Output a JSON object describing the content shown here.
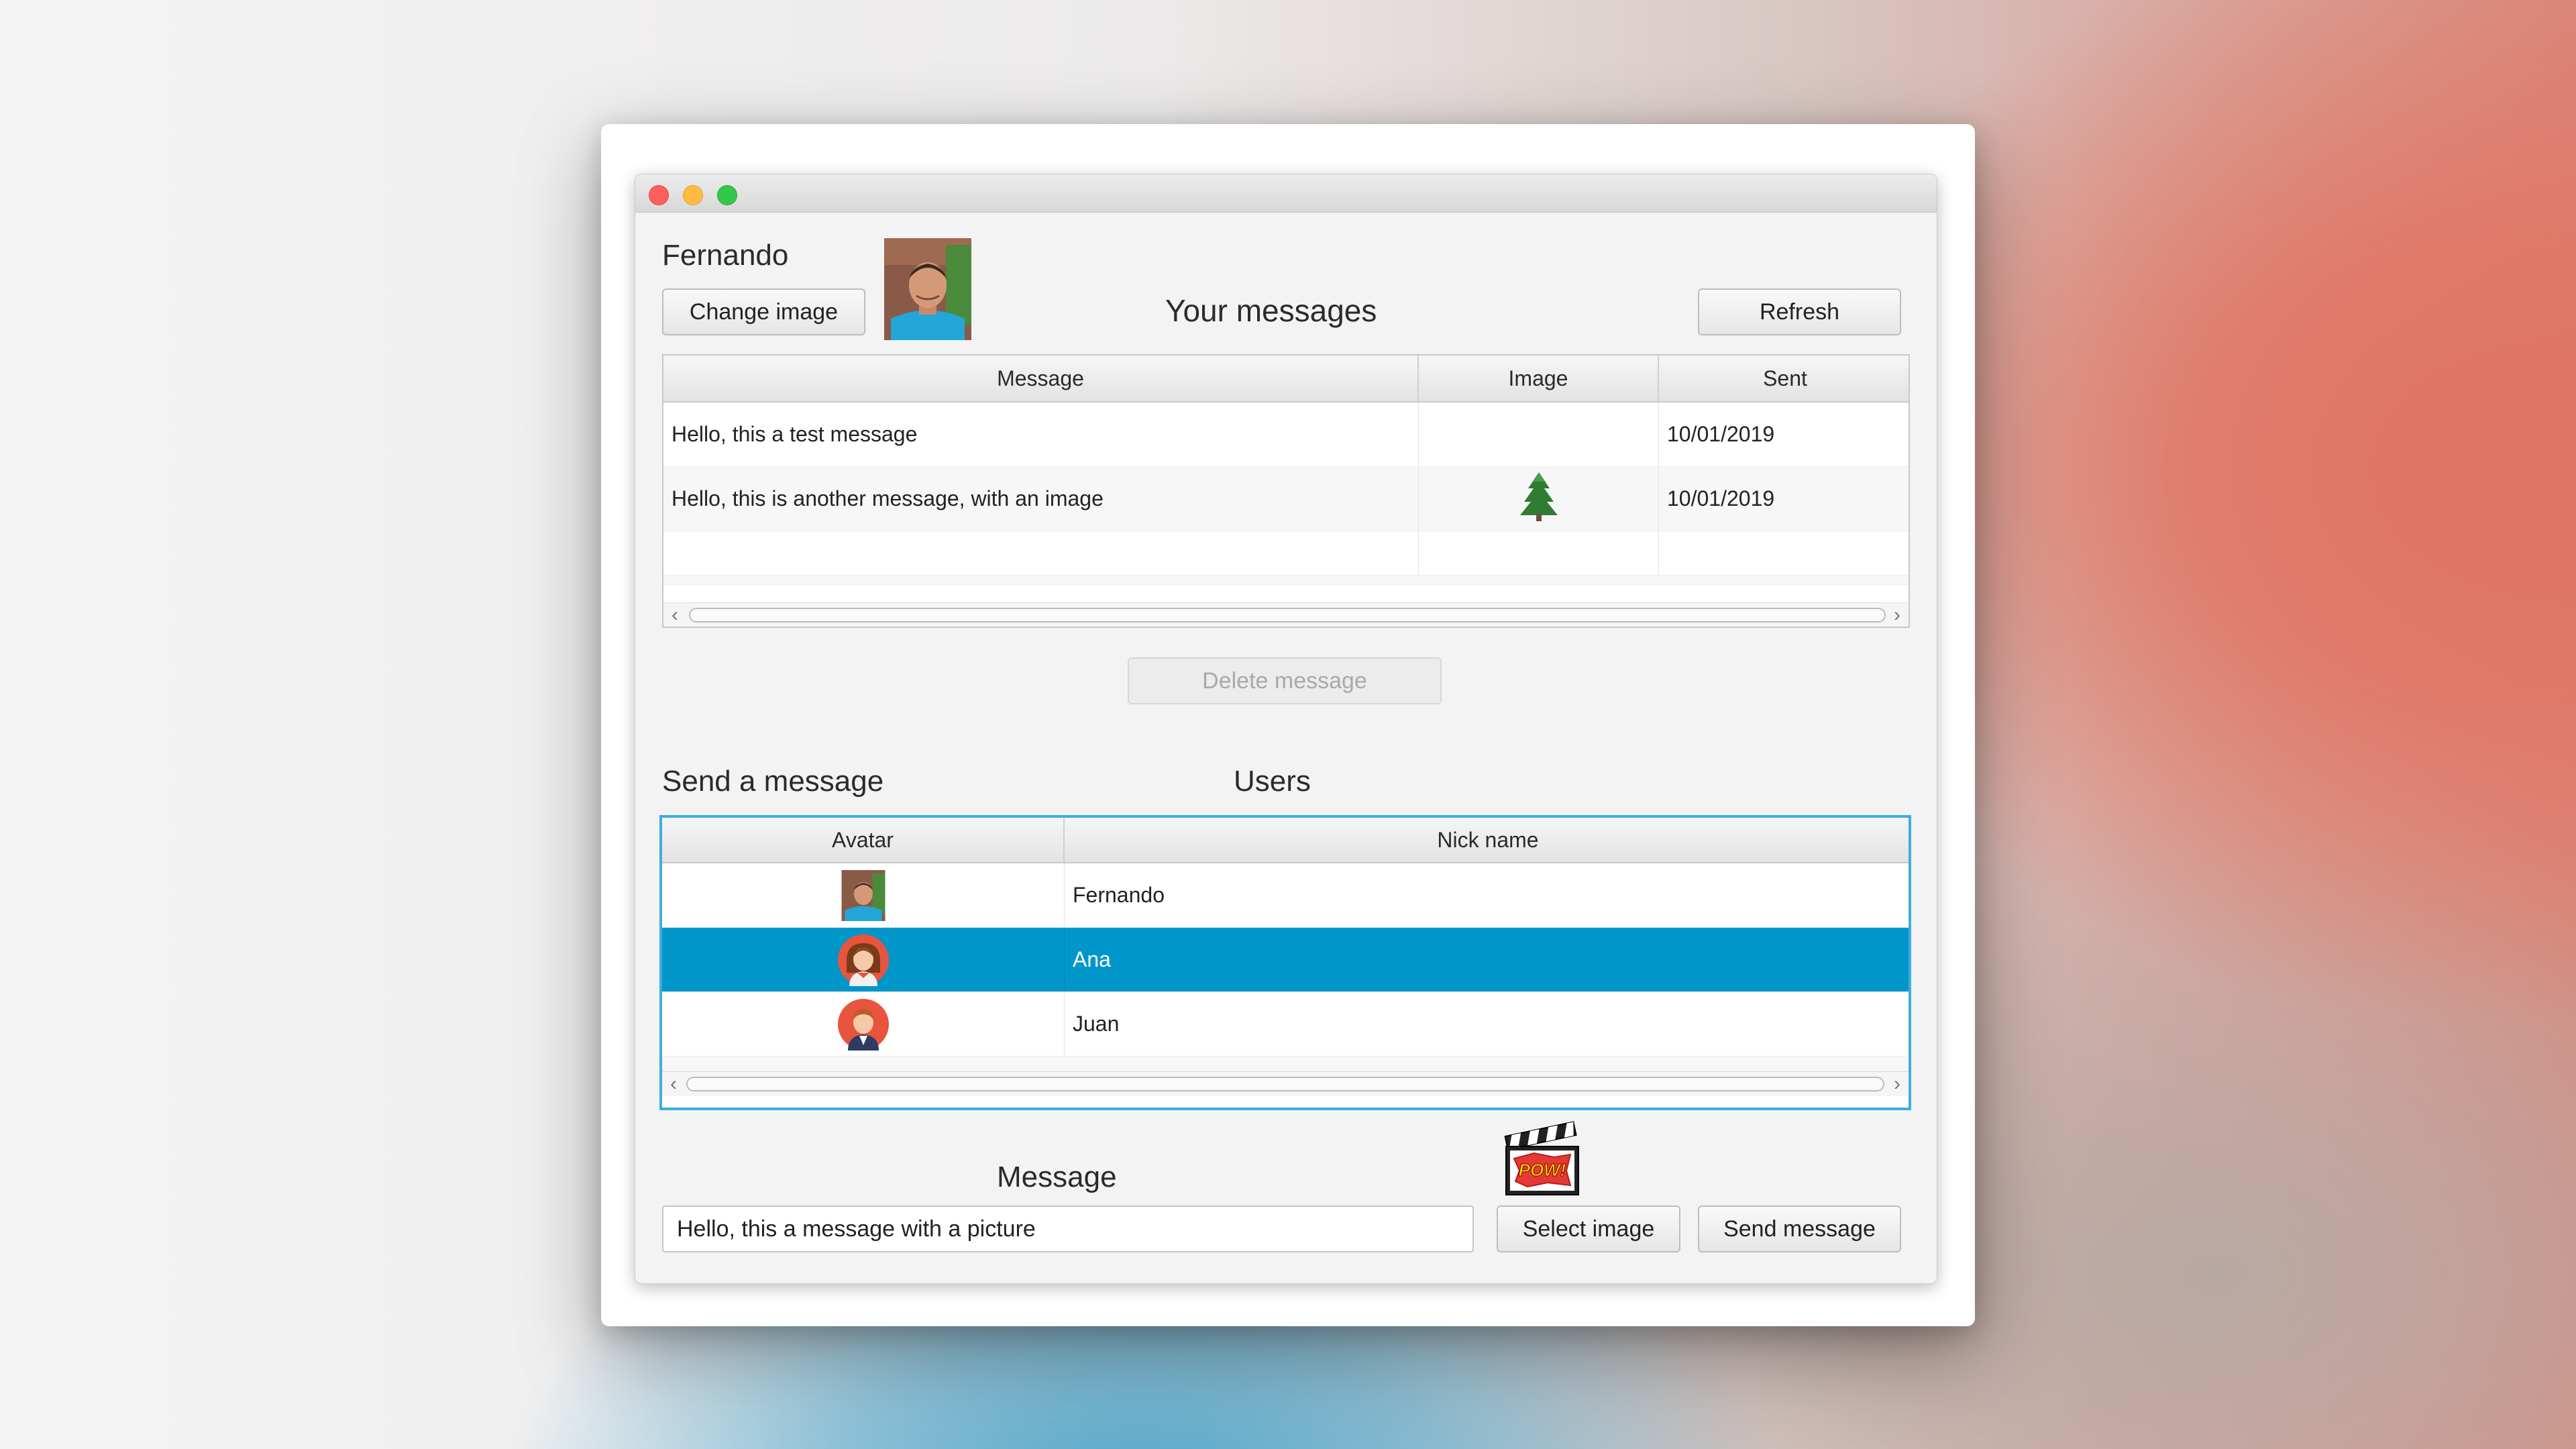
{
  "app": {
    "user_name": "Fernando",
    "change_image_label": "Change image",
    "your_messages_title": "Your messages",
    "refresh_label": "Refresh",
    "user_photo_icon": "man-photo-icon"
  },
  "messages_table": {
    "columns": [
      "Message",
      "Image",
      "Sent"
    ],
    "rows": [
      {
        "message": "Hello, this a test message",
        "image": "",
        "sent": "10/01/2019"
      },
      {
        "message": "Hello, this is another message, with an image",
        "image": "tree-icon",
        "sent": "10/01/2019"
      }
    ]
  },
  "delete_label": "Delete message",
  "send_section": {
    "title": "Send a message",
    "users_title": "Users"
  },
  "users_table": {
    "columns": [
      "Avatar",
      "Nick name"
    ],
    "rows": [
      {
        "avatar": "man-photo-icon",
        "nick": "Fernando"
      },
      {
        "avatar": "woman-avatar-icon",
        "nick": "Ana",
        "selected": true
      },
      {
        "avatar": "man-avatar-icon",
        "nick": "Juan"
      }
    ],
    "selected_color": "#0096c9"
  },
  "compose": {
    "message_label": "Message",
    "message_value": "Hello, this a message with a picture",
    "select_image_label": "Select image",
    "send_label": "Send message",
    "attachment_icon": "clapperboard-pow-icon"
  }
}
